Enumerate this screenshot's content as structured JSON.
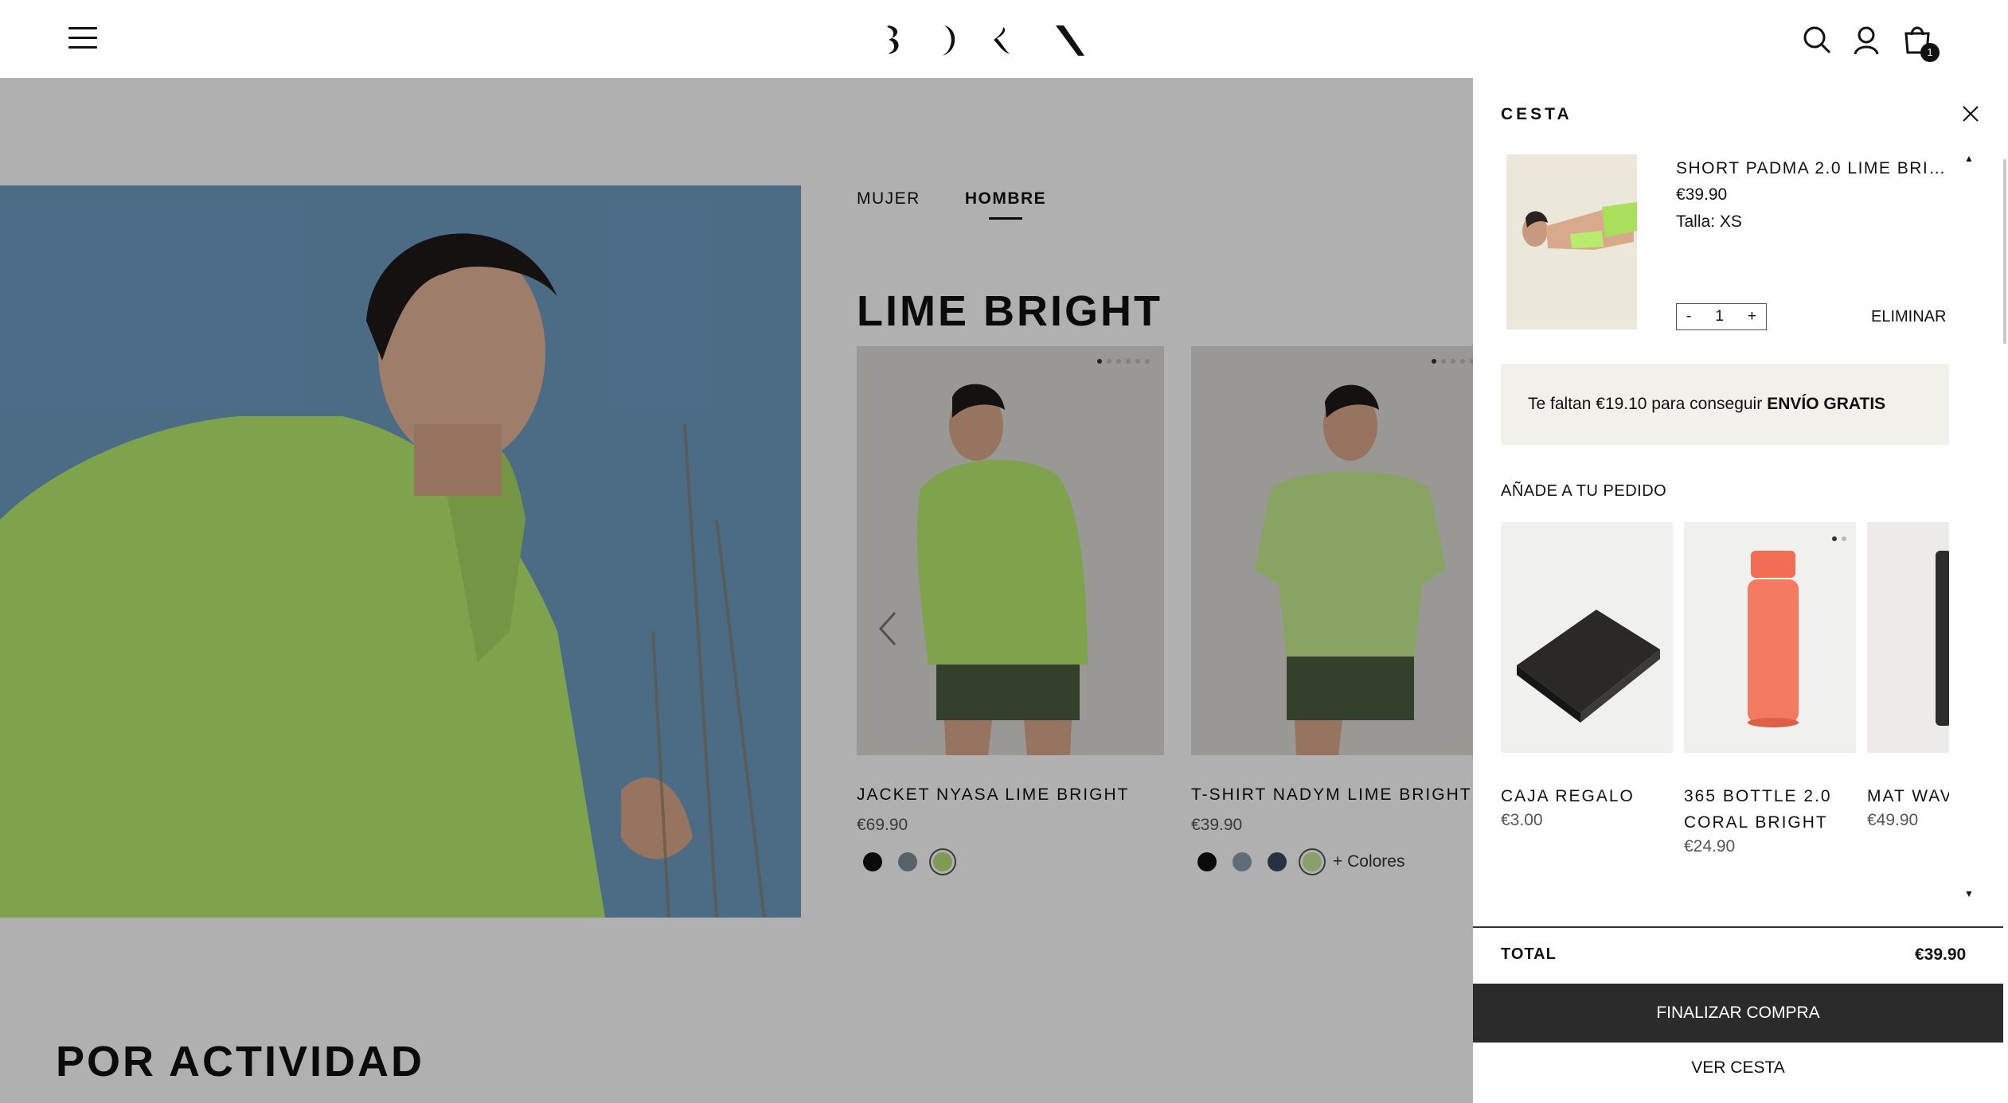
{
  "header": {
    "menu_icon": "hamburger-menu-icon",
    "logo_icon": "born-logo",
    "search_icon": "search-icon",
    "account_icon": "user-icon",
    "cart_icon": "shopping-bag-icon",
    "cart_count": "1"
  },
  "main": {
    "tabs": [
      {
        "label": "MUJER",
        "active": false
      },
      {
        "label": "HOMBRE",
        "active": true
      }
    ],
    "section_title": "LIME BRIGHT",
    "products": [
      {
        "name": "JACKET NYASA LIME BRIGHT",
        "price": "€69.90",
        "swatches": [
          "#111111",
          "#7b8f9a",
          "#b7e07a"
        ],
        "selected_swatch": 2
      },
      {
        "name": "T-SHIRT NADYM LIME BRIGHT",
        "price": "€39.90",
        "swatches": [
          "#111111",
          "#8a9cb0",
          "#3b4760",
          "#c8e89b"
        ],
        "selected_swatch": 3,
        "more_colors": "+ Colores"
      }
    ],
    "bottom_title": "POR ACTIVIDAD"
  },
  "cart": {
    "title": "CESTA",
    "item": {
      "name": "SHORT PADMA 2.0 LIME BRIG...",
      "price": "€39.90",
      "size": "Talla: XS",
      "qty": "1",
      "minus": "-",
      "plus": "+",
      "remove_label": "ELIMINAR"
    },
    "shipping_prefix": "Te faltan €19.10 para conseguir",
    "shipping_bold": "ENVÍO GRATIS",
    "upsell_title": "AÑADE A TU PEDIDO",
    "upsell": [
      {
        "name": "CAJA REGALO",
        "price": "€3.00"
      },
      {
        "name": "365 BOTTLE 2.0 CORAL BRIGHT",
        "price": "€24.90"
      },
      {
        "name": "MAT WAVE BLACK",
        "price": "€49.90"
      }
    ],
    "total_label": "TOTAL",
    "total_value": "€39.90",
    "checkout_label": "FINALIZAR COMPRA",
    "view_cart_label": "VER CESTA"
  },
  "colors": {
    "accent_lime": "#b7e07a",
    "checkout_bg": "#2b2b2b",
    "shipping_bg": "#f2f0ea"
  }
}
